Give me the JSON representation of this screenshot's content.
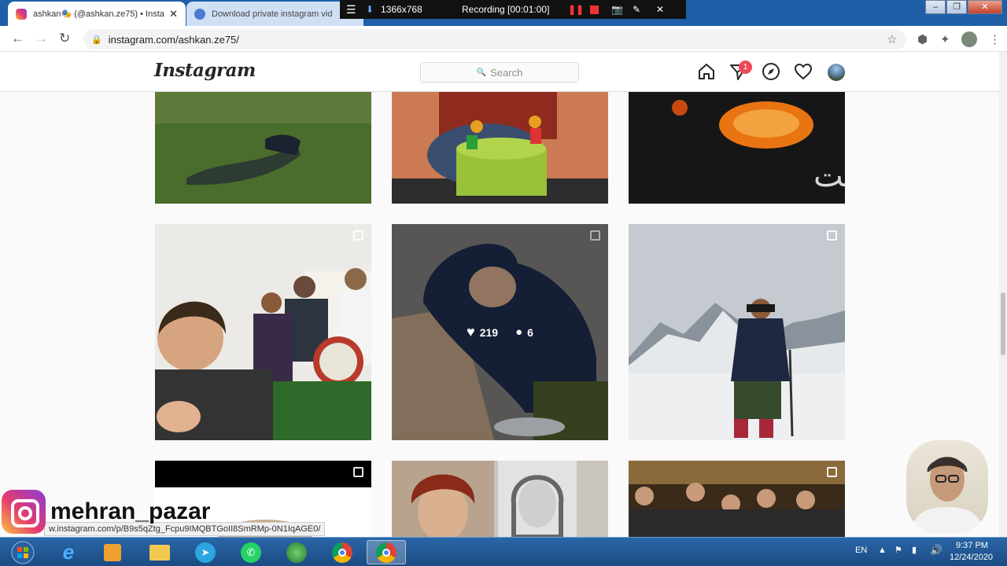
{
  "browser": {
    "tabs": [
      {
        "title": "ashkan🎭 (@ashkan.ze75) • Insta"
      },
      {
        "title": "Download private instagram vid"
      }
    ],
    "url": "instagram.com/ashkan.ze75/"
  },
  "recorder": {
    "resolution": "1366x768",
    "status": "Recording [00:01:00]"
  },
  "instagram": {
    "logo": "Instagram",
    "search_placeholder": "Search",
    "notification_count": "1"
  },
  "posts": [
    {
      "id": "r0c0",
      "scene": "grass"
    },
    {
      "id": "r0c1",
      "scene": "cake"
    },
    {
      "id": "r0c2",
      "scene": "fire",
      "caption_text": "ک سال گذشت"
    },
    {
      "id": "r1c0",
      "scene": "family",
      "multi": true
    },
    {
      "id": "r1c1",
      "scene": "hood",
      "multi": true,
      "hovered": true,
      "likes": "219",
      "comments": "6"
    },
    {
      "id": "r1c2",
      "scene": "mountain",
      "multi": true
    },
    {
      "id": "r2c0",
      "scene": "black",
      "multi": true
    },
    {
      "id": "r2c1",
      "scene": "portraits"
    },
    {
      "id": "r2c2",
      "scene": "dinner",
      "multi": true
    }
  ],
  "status_link": "w.instagram.com/p/B9s5qZtg_Fcpu9IMQBTGoII8SmRMp-0N1IqAGE0/",
  "watermark": {
    "name": "mehran_pazar"
  },
  "taskbar": {
    "lang": "EN",
    "time": "9:37 PM",
    "date": "12/24/2020",
    "apps": [
      "start-orb",
      "ie",
      "media-player",
      "explorer",
      "telegram",
      "whatsapp",
      "idm",
      "chrome",
      "chrome-active"
    ]
  }
}
